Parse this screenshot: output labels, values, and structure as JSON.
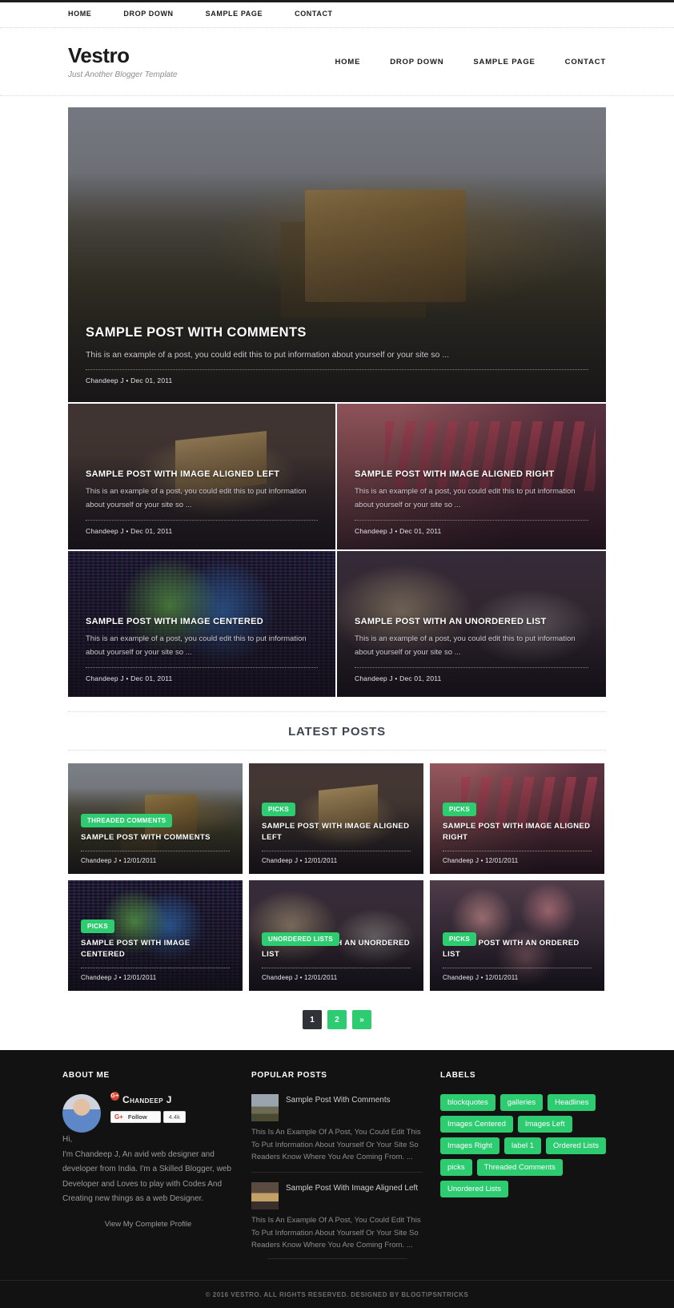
{
  "topnav": {
    "items": [
      "HOME",
      "DROP DOWN",
      "SAMPLE PAGE",
      "CONTACT"
    ]
  },
  "brand": {
    "title": "Vestro",
    "tagline": "Just Another Blogger Template"
  },
  "mainnav": {
    "items": [
      "HOME",
      "DROP DOWN",
      "SAMPLE PAGE",
      "CONTACT"
    ]
  },
  "featured": {
    "hero": {
      "title": "SAMPLE POST WITH COMMENTS",
      "excerpt": "This is an example of a post, you could edit this to put information about yourself or your site so ...",
      "meta": "Chandeep J • Dec 01, 2011"
    },
    "items": [
      {
        "title": "SAMPLE POST WITH IMAGE ALIGNED LEFT",
        "excerpt": "This is an example of a post, you could edit this to put information about yourself or your site so ...",
        "meta": "Chandeep J • Dec 01, 2011"
      },
      {
        "title": "SAMPLE POST WITH IMAGE ALIGNED RIGHT",
        "excerpt": "This is an example of a post, you could edit this to put information about yourself or your site so ...",
        "meta": "Chandeep J • Dec 01, 2011"
      },
      {
        "title": "SAMPLE POST WITH IMAGE CENTERED",
        "excerpt": "This is an example of a post, you could edit this to put information about yourself or your site so ...",
        "meta": "Chandeep J • Dec 01, 2011"
      },
      {
        "title": "SAMPLE POST WITH AN UNORDERED LIST",
        "excerpt": "This is an example of a post, you could edit this to put information about yourself or your site so ...",
        "meta": "Chandeep J • Dec 01, 2011"
      }
    ]
  },
  "latest": {
    "heading": "LATEST POSTS",
    "cards": [
      {
        "badge": "THREADED COMMENTS",
        "title": "SAMPLE POST WITH COMMENTS",
        "meta": "Chandeep J  •  12/01/2011"
      },
      {
        "badge": "PICKS",
        "title": "SAMPLE POST WITH IMAGE ALIGNED LEFT",
        "meta": "Chandeep J  •  12/01/2011"
      },
      {
        "badge": "PICKS",
        "title": "SAMPLE POST WITH IMAGE ALIGNED RIGHT",
        "meta": "Chandeep J  •  12/01/2011"
      },
      {
        "badge": "PICKS",
        "title": "SAMPLE POST WITH IMAGE CENTERED",
        "meta": "Chandeep J  •  12/01/2011"
      },
      {
        "badge": "UNORDERED LISTS",
        "title": "SAMPLE POST WITH AN UNORDERED LIST",
        "meta": "Chandeep J  •  12/01/2011"
      },
      {
        "badge": "PICKS",
        "title": "SAMPLE POST WITH AN ORDERED LIST",
        "meta": "Chandeep J  •  12/01/2011"
      }
    ]
  },
  "pagination": {
    "pages": [
      "1",
      "2",
      "»"
    ],
    "current": "1"
  },
  "footer": {
    "about": {
      "heading": "ABOUT ME",
      "name": "Chandeep J",
      "gplus_glyph": "G+",
      "follow_label": "Follow",
      "follow_count": "4.4k",
      "greeting": "Hi,",
      "bio": "I'm Chandeep J, An avid web designer and developer from India. I'm a Skilled Blogger, web Developer and Loves to play with Codes And Creating new things as a web Designer.",
      "profile_link": "View My Complete Profile"
    },
    "popular": {
      "heading": "POPULAR POSTS",
      "items": [
        {
          "title": "Sample Post With Comments",
          "excerpt": "This Is An Example Of A Post, You Could Edit This To Put Information About Yourself Or Your Site So Readers Know Where You Are Coming From. ..."
        },
        {
          "title": "Sample Post With Image Aligned Left",
          "excerpt": "This Is An Example Of A Post, You Could Edit This To Put Information About Yourself Or Your Site So Readers Know Where You Are Coming From. ..."
        }
      ]
    },
    "labels": {
      "heading": "LABELS",
      "tags": [
        "blockquotes",
        "galleries",
        "Headlines",
        "Images Centered",
        "Images Left",
        "Images Right",
        "label 1",
        "Ordered Lists",
        "picks",
        "Threaded Comments",
        "Unordered Lists"
      ]
    },
    "copyright": "© 2016 VESTRO. ALL RIGHTS RESERVED. DESIGNED BY BLOGTIPSNTRICKS"
  },
  "colors": {
    "accent": "#2ecc71",
    "dark": "#2f3237",
    "footer_bg": "#121212"
  }
}
